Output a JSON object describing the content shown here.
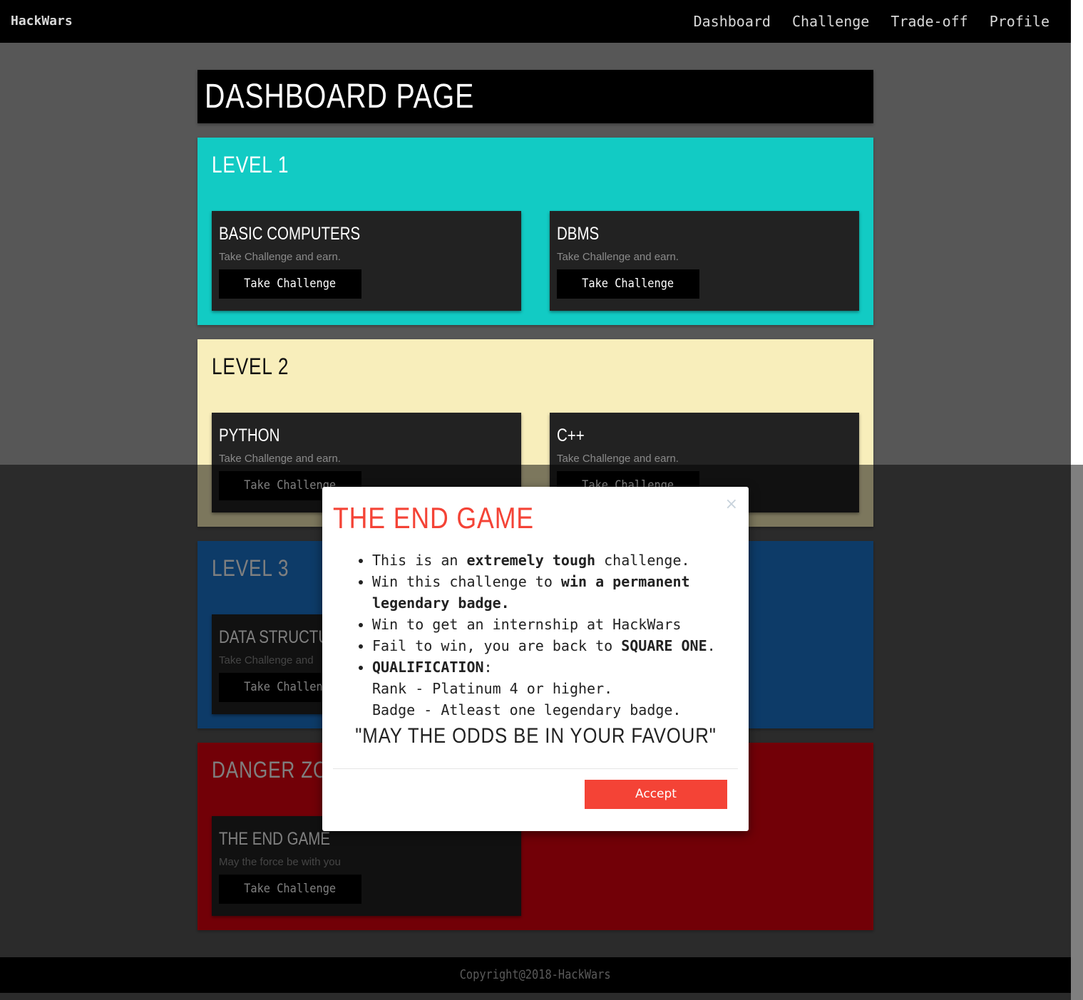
{
  "navbar": {
    "brand": "HackWars",
    "links": [
      "Dashboard",
      "Challenge",
      "Trade-off",
      "Profile"
    ]
  },
  "page_title": "DASHBOARD PAGE",
  "levels": [
    {
      "title": "LEVEL 1",
      "bg": "#12cbc4",
      "title_color": "#ffffff",
      "cards": [
        {
          "title": "BASIC COMPUTERS",
          "text": "Take Challenge and earn.",
          "button": "Take Challenge"
        },
        {
          "title": "DBMS",
          "text": "Take Challenge and earn.",
          "button": "Take Challenge"
        }
      ]
    },
    {
      "title": "LEVEL 2",
      "bg": "#f8eebb",
      "title_color": "#111111",
      "cards": [
        {
          "title": "PYTHON",
          "text": "Take Challenge and earn.",
          "button": "Take Challenge"
        },
        {
          "title": "C++",
          "text": "Take Challenge and earn.",
          "button": "Take Challenge"
        }
      ]
    },
    {
      "title": "LEVEL 3",
      "bg": "#1b76d1",
      "title_color": "#ffffff",
      "cards": [
        {
          "title": "DATA STRUCTU",
          "text": "Take Challenge and",
          "button": "Take Challenge"
        }
      ]
    },
    {
      "title": "DANGER ZONE",
      "bg": "#e4000f",
      "title_color": "#ffffff",
      "cards": [
        {
          "title": "THE END GAME",
          "text": "May the force be with you",
          "button": "Take Challenge"
        }
      ]
    }
  ],
  "footer": "Copyright@2018-HackWars",
  "modal": {
    "title": "THE END GAME",
    "close_label": "×",
    "items": [
      {
        "parts": [
          "This is an ",
          "extremely tough",
          " challenge."
        ]
      },
      {
        "parts": [
          "Win this challenge to ",
          "win a permanent legendary badge.",
          ""
        ]
      },
      {
        "parts": [
          "Win to get an internship at HackWars",
          "",
          ""
        ]
      },
      {
        "parts": [
          "Fail to win, you are back to ",
          "SQUARE ONE",
          "."
        ]
      },
      {
        "parts": [
          "",
          "QUALIFICATION",
          ":"
        ]
      }
    ],
    "qualification_lines": [
      "Rank - Platinum 4 or higher.",
      "Badge - Atleast one legendary badge."
    ],
    "quote": "\"MAY THE ODDS BE IN YOUR FAVOUR\"",
    "accept_label": "Accept"
  }
}
